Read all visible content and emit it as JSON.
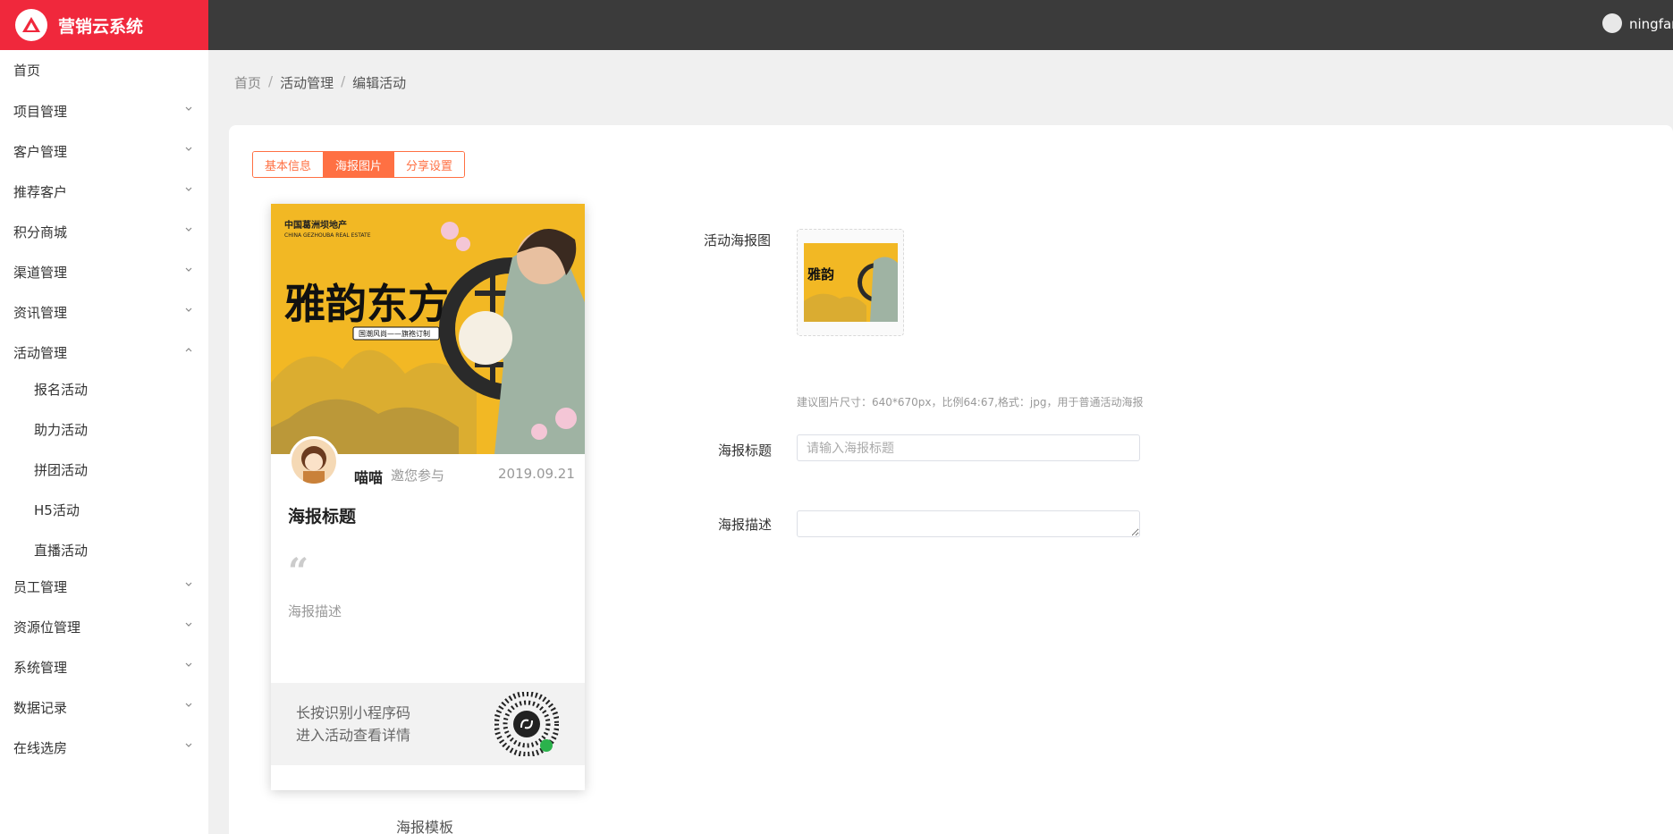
{
  "app": {
    "title": "营销云系统"
  },
  "user": {
    "name": "ningfan"
  },
  "sidebar": {
    "items": [
      {
        "label": "首页",
        "caret": ""
      },
      {
        "label": "项目管理",
        "caret": "down"
      },
      {
        "label": "客户管理",
        "caret": "down"
      },
      {
        "label": "推荐客户",
        "caret": "down"
      },
      {
        "label": "积分商城",
        "caret": "down"
      },
      {
        "label": "渠道管理",
        "caret": "down"
      },
      {
        "label": "资讯管理",
        "caret": "down"
      },
      {
        "label": "活动管理",
        "caret": "up"
      },
      {
        "label": "报名活动",
        "caret": ""
      },
      {
        "label": "助力活动",
        "caret": ""
      },
      {
        "label": "拼团活动",
        "caret": ""
      },
      {
        "label": "H5活动",
        "caret": ""
      },
      {
        "label": "直播活动",
        "caret": ""
      },
      {
        "label": "员工管理",
        "caret": "down"
      },
      {
        "label": "资源位管理",
        "caret": "down"
      },
      {
        "label": "系统管理",
        "caret": "down"
      },
      {
        "label": "数据记录",
        "caret": "down"
      },
      {
        "label": "在线选房",
        "caret": "down"
      }
    ]
  },
  "breadcrumb": {
    "home": "首页",
    "section": "活动管理",
    "current": "编辑活动",
    "separator": "/"
  },
  "tabs": [
    {
      "label": "基本信息",
      "active": false
    },
    {
      "label": "海报图片",
      "active": true
    },
    {
      "label": "分享设置",
      "active": false
    }
  ],
  "poster": {
    "brand_cn": "中国葛洲坝地产",
    "brand_en": "CHINA GEZHOUBA REAL ESTATE",
    "headline": "雅韵东方",
    "tagline": "国潮风尚——旗袍订制",
    "nickname": "喵喵",
    "invite_text": "邀您参与",
    "date": "2019.09.21",
    "title": "海报标题",
    "quote_mark": "“",
    "description": "海报描述",
    "footer_line1": "长按识别小程序码",
    "footer_line2": "进入活动查看详情",
    "template_label": "海报模板"
  },
  "form": {
    "poster_image_label": "活动海报图",
    "hint": "建议图片尺寸：640*670px，比例64:67,格式：jpg，用于普通活动海报",
    "title_label": "海报标题",
    "title_placeholder": "请输入海报标题",
    "title_value": "",
    "desc_label": "海报描述",
    "desc_value": ""
  },
  "colors": {
    "brand": "#f0283c",
    "topbar": "#3b3b3b",
    "accent": "#ff7043",
    "poster_yellow": "#f2b824"
  }
}
